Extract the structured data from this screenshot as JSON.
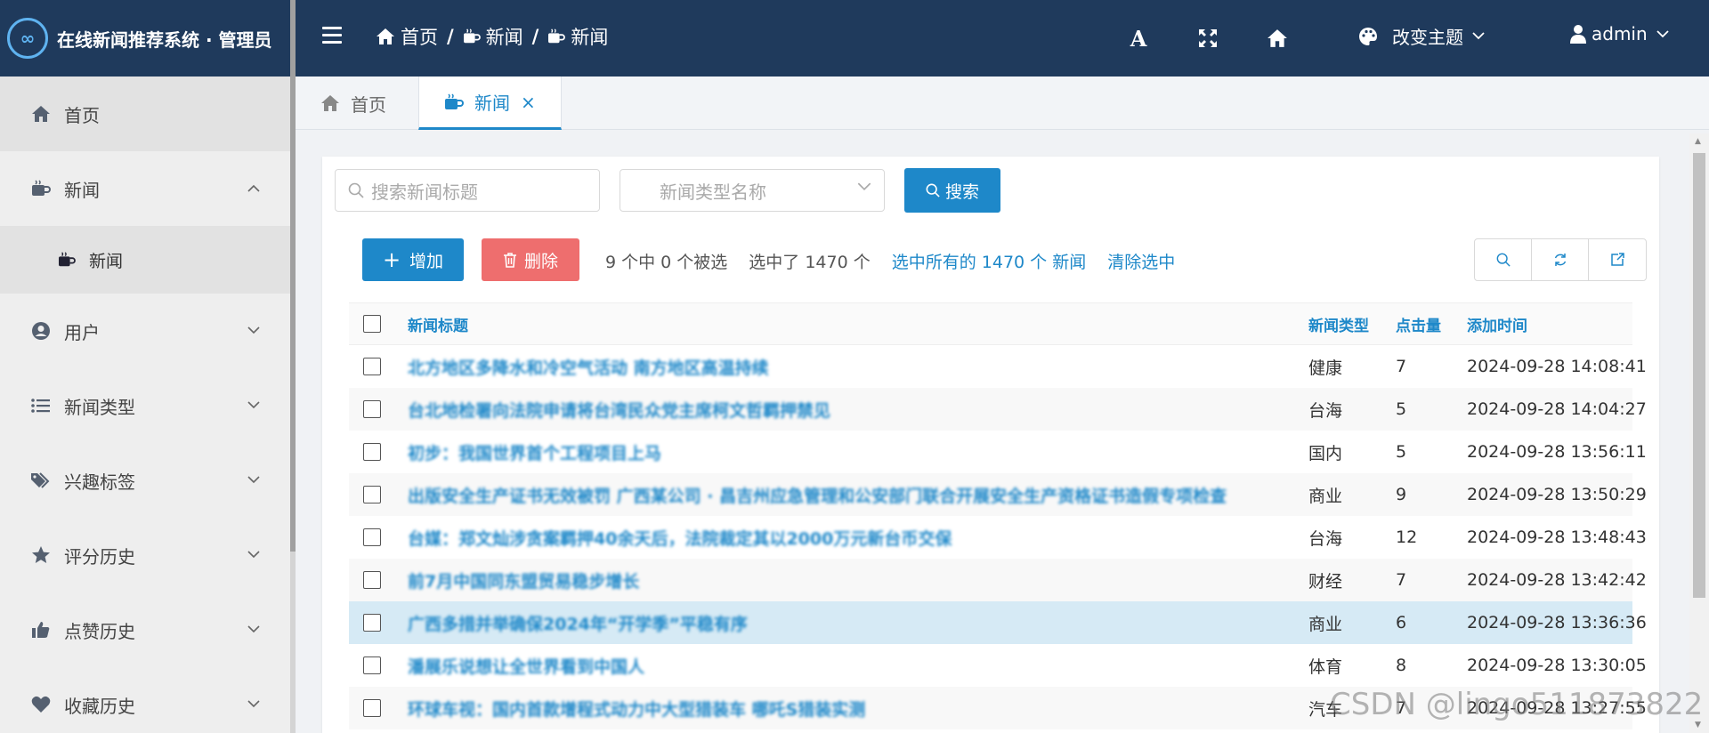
{
  "brand": {
    "logo": "∞",
    "title": "在线新闻推荐系统 · 管理员"
  },
  "sidebar": {
    "items": [
      {
        "label": "首页",
        "icon": "home-icon"
      },
      {
        "label": "新闻",
        "icon": "coffee-icon"
      },
      {
        "label": "新闻",
        "icon": "coffee-icon",
        "sub": true
      },
      {
        "label": "用户",
        "icon": "user-circle-icon"
      },
      {
        "label": "新闻类型",
        "icon": "list-icon"
      },
      {
        "label": "兴趣标签",
        "icon": "tags-icon"
      },
      {
        "label": "评分历史",
        "icon": "star-icon"
      },
      {
        "label": "点赞历史",
        "icon": "thumbs-up-icon"
      },
      {
        "label": "收藏历史",
        "icon": "heart-icon"
      }
    ]
  },
  "header": {
    "breadcrumb": [
      "首页",
      "新闻",
      "新闻"
    ],
    "theme_label": "改变主题",
    "user_label": "admin",
    "font_icon_label": "A"
  },
  "tabs": [
    {
      "label": "首页",
      "active": false
    },
    {
      "label": "新闻",
      "active": true,
      "close": "×"
    }
  ],
  "search": {
    "title_placeholder": "搜索新闻标题",
    "type_placeholder": "新闻类型名称",
    "button_label": "搜索"
  },
  "actions": {
    "add_label": "增加",
    "delete_label": "删除",
    "selection_count": "9 个中 0 个被选",
    "selected_total": "选中了 1470 个",
    "select_all": "选中所有的 1470 个 新闻",
    "clear_selection": "清除选中"
  },
  "table": {
    "headers": {
      "title": "新闻标题",
      "type": "新闻类型",
      "clicks": "点击量",
      "time": "添加时间"
    },
    "rows": [
      {
        "title": "北方地区多降水和冷空气活动 南方地区高温持续",
        "type": "健康",
        "clicks": "7",
        "time": "2024-09-28 14:08:41"
      },
      {
        "title": "台北地检署向法院申请将台湾民众党主席柯文哲羁押禁见",
        "type": "台海",
        "clicks": "5",
        "time": "2024-09-28 14:04:27"
      },
      {
        "title": "初步：我国世界首个工程项目上马",
        "type": "国内",
        "clicks": "5",
        "time": "2024-09-28 13:56:11"
      },
      {
        "title": "出版安全生产证书无效被罚 广西某公司 · 昌吉州应急管理和公安部门联合开展安全生产资格证书造假专项检查",
        "type": "商业",
        "clicks": "9",
        "time": "2024-09-28 13:50:29"
      },
      {
        "title": "台媒：郑文灿涉贪案羁押40余天后，法院裁定其以2000万元新台币交保",
        "type": "台海",
        "clicks": "12",
        "time": "2024-09-28 13:48:43"
      },
      {
        "title": "前7月中国同东盟贸易稳步增长",
        "type": "财经",
        "clicks": "7",
        "time": "2024-09-28 13:42:42"
      },
      {
        "title": "广西多措并举确保2024年“开学季”平稳有序",
        "type": "商业",
        "clicks": "6",
        "time": "2024-09-28 13:36:36"
      },
      {
        "title": "潘展乐说想让全世界看到中国人",
        "type": "体育",
        "clicks": "8",
        "time": "2024-09-28 13:30:05"
      },
      {
        "title": "环球车视：国内首款增程式动力中大型猎装车 哪吒S猎装实测",
        "type": "汽车",
        "clicks": "7",
        "time": "2024-09-28 13:27:55"
      }
    ]
  },
  "watermark": "CSDN @lingo511873822",
  "colors": {
    "header_bg": "#1f3a5c",
    "accent": "#1e88c9",
    "danger": "#ee6e6e",
    "highlight_row": "#d6eaf5"
  }
}
